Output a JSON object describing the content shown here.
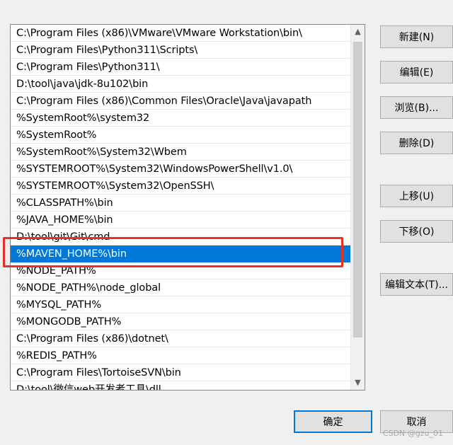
{
  "path_list": {
    "items": [
      "C:\\Program Files (x86)\\VMware\\VMware Workstation\\bin\\",
      "C:\\Program Files\\Python311\\Scripts\\",
      "C:\\Program Files\\Python311\\",
      "D:\\tool\\java\\jdk-8u102\\bin",
      "C:\\Program Files (x86)\\Common Files\\Oracle\\Java\\javapath",
      "%SystemRoot%\\system32",
      "%SystemRoot%",
      "%SystemRoot%\\System32\\Wbem",
      "%SYSTEMROOT%\\System32\\WindowsPowerShell\\v1.0\\",
      "%SYSTEMROOT%\\System32\\OpenSSH\\",
      "%CLASSPATH%\\bin",
      "%JAVA_HOME%\\bin",
      "D:\\tool\\git\\Git\\cmd",
      "%MAVEN_HOME%\\bin",
      "%NODE_PATH%",
      "%NODE_PATH%\\node_global",
      "%MYSQL_PATH%",
      "%MONGODB_PATH%",
      "C:\\Program Files (x86)\\dotnet\\",
      "%REDIS_PATH%",
      "C:\\Program Files\\TortoiseSVN\\bin",
      "D:\\tool\\微信web开发者工具\\dll"
    ],
    "selected_index": 13
  },
  "buttons": {
    "new": "新建(N)",
    "edit": "编辑(E)",
    "browse": "浏览(B)...",
    "delete": "删除(D)",
    "move_up": "上移(U)",
    "move_down": "下移(O)",
    "edit_text": "编辑文本(T)...",
    "ok": "确定",
    "cancel": "取消"
  },
  "icons": {
    "scroll_up": "scroll-up-arrow-icon",
    "scroll_down": "scroll-down-arrow-icon"
  },
  "colors": {
    "selection": "#0078d7",
    "highlight_box": "#e5312a",
    "background": "#f0f0f0"
  },
  "watermark": "CSDN @gzu_01"
}
